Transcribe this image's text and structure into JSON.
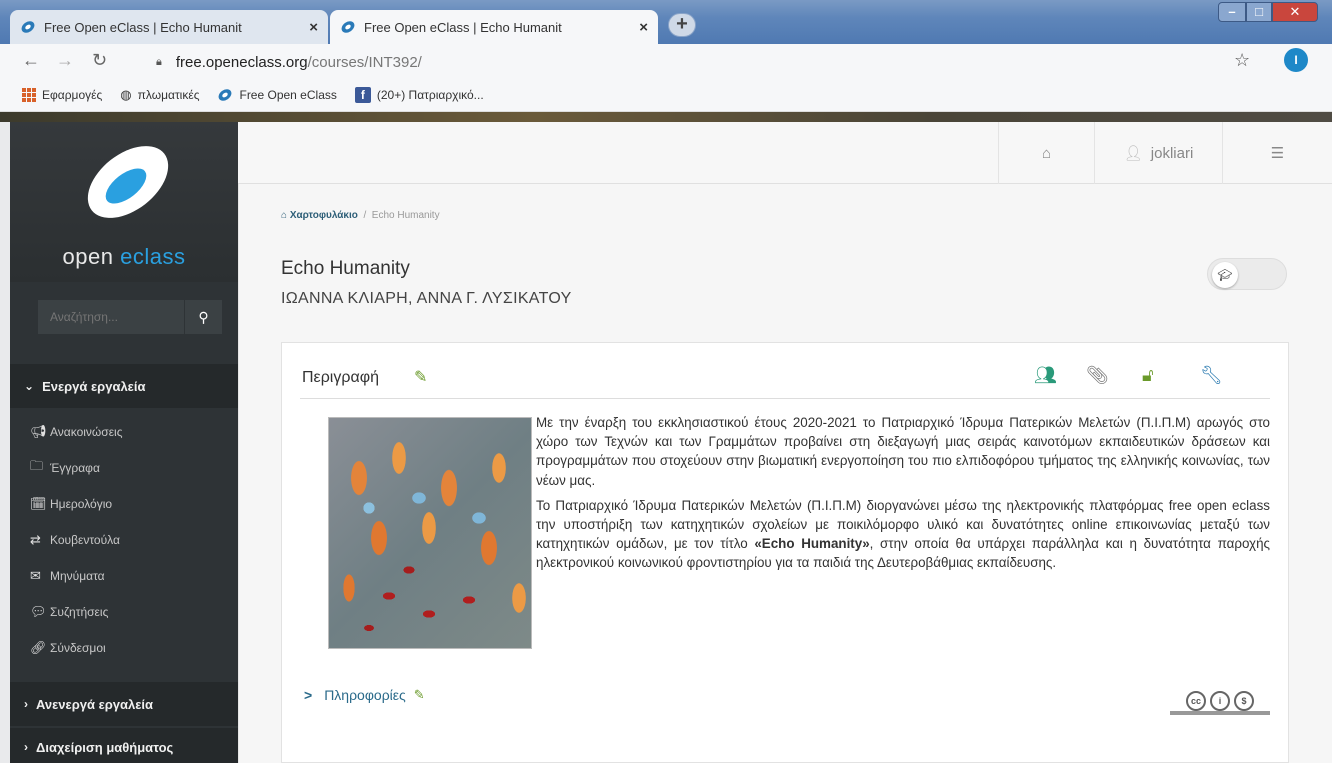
{
  "browser": {
    "tabs": [
      {
        "title": "Free Open eClass | Echo Humanit",
        "active": false
      },
      {
        "title": "Free Open eClass | Echo Humanit",
        "active": true
      }
    ],
    "new_tab_label": "+",
    "close_label": "×",
    "url_host": "free.openeclass.org",
    "url_path": "/courses/INT392/",
    "profile_initial": "I",
    "bookmarks": [
      {
        "label": "Εφαρμογές",
        "icon": "apps-grid-icon"
      },
      {
        "label": "πλωματικές",
        "icon": "globe-icon"
      },
      {
        "label": "Free Open eClass",
        "icon": "eclass-icon"
      },
      {
        "label": "(20+) Πατριαρχικό...",
        "icon": "facebook-icon"
      }
    ]
  },
  "sidebar": {
    "logo_text_before": "open ",
    "logo_text_accent": "eclass",
    "search_placeholder": "Αναζήτηση...",
    "active_section": "Ενεργά εργαλεία",
    "tools": [
      {
        "label": "Ανακοινώσεις",
        "icon": "megaphone-icon"
      },
      {
        "label": "Έγγραφα",
        "icon": "folder-icon"
      },
      {
        "label": "Ημερολόγιο",
        "icon": "calendar-icon"
      },
      {
        "label": "Κουβεντούλα",
        "icon": "exchange-icon"
      },
      {
        "label": "Μηνύματα",
        "icon": "envelope-icon"
      },
      {
        "label": "Συζητήσεις",
        "icon": "comments-icon"
      },
      {
        "label": "Σύνδεσμοι",
        "icon": "link-icon"
      }
    ],
    "inactive_section": "Ανενεργά εργαλεία",
    "admin_section": "Διαχείριση μαθήματος"
  },
  "header": {
    "username": "jokliari"
  },
  "breadcrumb": {
    "home": "Χαρτοφυλάκιο",
    "separator": "/",
    "current": "Echo Humanity"
  },
  "course": {
    "title": "Echo Humanity",
    "teachers": "ΙΩΑΝΝΑ ΚΛΙΑΡΗ, ΑΝΝΑ Γ. ΛΥΣΙΚΑΤΟΥ"
  },
  "description": {
    "heading": "Περιγραφή",
    "paragraph1": "Με την έναρξη του εκκλησιαστικού έτους 2020-2021 το Πατριαρχικό Ίδρυμα Πατερικών Μελετών (Π.Ι.Π.Μ) αρωγός στο χώρο των Τεχνών και των Γραμμάτων προβαίνει στη διεξαγωγή μιας σειράς καινοτόμων εκπαιδευτικών δράσεων και προγραμμάτων που στοχεύουν στην βιωματική ενεργοποίηση του πιο ελπιδοφόρου τμήματος της ελληνικής κοινωνίας, των νέων μας.",
    "paragraph2_before": "Το Πατριαρχικό Ίδρυμα Πατερικών Μελετών (Π.Ι.Π.Μ) διοργανώνει μέσω της ηλεκτρονικής πλατφόρμας free open eclass την υποστήριξη των κατηχητικών σχολείων με ποικιλόμορφο υλικό και δυνατότητες online επικοινωνίας μεταξύ των κατηχητικών ομάδων, με τον τίτλο ",
    "paragraph2_bold": "«Echo Humanity»",
    "paragraph2_after": ", στην οποία θα υπάρχει παράλληλα και η δυνατότητα παροχής ηλεκτρονικού κοινωνικού φροντιστηρίου για τα παιδιά της Δευτεροβάθμιας εκπαίδευσης.",
    "info_label": "Πληροφορίες",
    "license_label": "cc"
  },
  "colors": {
    "sidebar_bg": "#2e3336",
    "accent_blue": "#2aa0e0",
    "edit_green": "#6a9a2a",
    "link_teal": "#2a6a8a"
  }
}
